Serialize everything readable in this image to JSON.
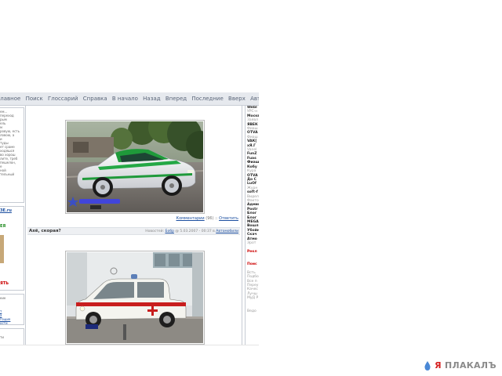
{
  "nav": {
    "items": [
      "Главное",
      "Поиск",
      "Глоссарий",
      "Справка",
      "В начало",
      "Назад",
      "Вперед",
      "Последние",
      "Вверх",
      "Авторское право"
    ]
  },
  "left_sidebar": {
    "box1_lines": [
      "ем...",
      "переход",
      "",
      "рым",
      "ель",
      "м",
      "ровую, есть",
      "ловою, а",
      "",
      "",
      "",
      "",
      "и",
      "туды",
      "",
      "ет сраме",
      "ходяшся",
      "во хорош",
      "лите, треб",
      "пешелон,",
      "е",
      "ной",
      "тельный"
    ],
    "box2_red": "ЗЕ.ru",
    "box2_green": "ЕЯ",
    "box2_red2": "ЯТЬ",
    "box3_lines": [
      "кик",
      "т",
      "а",
      "гощие",
      "ости"
    ],
    "box4_lines": [
      "",
      "ти"
    ]
  },
  "post1": {
    "comments_label": "Комментарии",
    "comments_count": "(96)",
    "reply_label": "Ответить"
  },
  "post2": {
    "title": "Ахё, скорая?",
    "author_label": "Новостей:",
    "author": "Бобр",
    "date": "@ 5.03.2007 - 00:37",
    "category_prefix": "в",
    "category": "Автомобили"
  },
  "right_sidebar": {
    "lines": [
      {
        "t": "Webl",
        "c": "b"
      },
      {
        "t": "УРС-н",
        "c": "g"
      },
      {
        "t": "Москв",
        "c": "b"
      },
      {
        "t": "Заявл",
        "c": "g"
      },
      {
        "t": "ЯВЕК",
        "c": "b"
      },
      {
        "t": "Фиаш",
        "c": "g"
      },
      {
        "t": "OTVA",
        "c": "b"
      },
      {
        "t": "Фиаш",
        "c": "g"
      },
      {
        "t": "VAК[",
        "c": "b"
      },
      {
        "t": "xЯ.Г",
        "c": "b"
      },
      {
        "t": "Vanel",
        "c": "g"
      },
      {
        "t": "FunZ",
        "c": "b"
      },
      {
        "t": "Fuas",
        "c": "b"
      },
      {
        "t": "Фиаш",
        "c": "b"
      },
      {
        "t": "Кобу",
        "c": "b"
      },
      {
        "t": "Кура",
        "c": "g"
      },
      {
        "t": "OTVA",
        "c": "b"
      },
      {
        "t": "До С",
        "c": "b"
      },
      {
        "t": "LuOf",
        "c": "b"
      },
      {
        "t": "Журн",
        "c": "g"
      },
      {
        "t": "soft-f",
        "c": "b"
      },
      {
        "t": "Видел",
        "c": "g"
      },
      {
        "t": "Факто",
        "c": "g"
      },
      {
        "t": "Админ",
        "c": "b"
      },
      {
        "t": "Postr",
        "c": "b"
      },
      {
        "t": "Блог",
        "c": "b"
      },
      {
        "t": "Блог",
        "c": "b"
      },
      {
        "t": "MEGA",
        "c": "b"
      },
      {
        "t": "Вошл",
        "c": "b"
      },
      {
        "t": "Убойн",
        "c": "b"
      },
      {
        "t": "Скач",
        "c": "b"
      },
      {
        "t": "Атмо",
        "c": "b"
      },
      {
        "t": "Эрот",
        "c": "g"
      },
      {
        "t": "",
        "c": "g"
      },
      {
        "t": "Рекл",
        "c": "r"
      },
      {
        "t": "",
        "c": "g"
      },
      {
        "t": "",
        "c": "g"
      },
      {
        "t": "Поис",
        "c": "r"
      },
      {
        "t": "",
        "c": "g"
      },
      {
        "t": "Всть",
        "c": "g"
      },
      {
        "t": "Подбо",
        "c": "g"
      },
      {
        "t": "Все п",
        "c": "g"
      },
      {
        "t": "Переу",
        "c": "g"
      },
      {
        "t": "Качес",
        "c": "g"
      },
      {
        "t": "Лучш",
        "c": "g"
      },
      {
        "t": "МуД Р",
        "c": "g"
      },
      {
        "t": "",
        "c": "g"
      },
      {
        "t": "",
        "c": "g"
      },
      {
        "t": "Ведо",
        "c": "g"
      }
    ]
  },
  "watermark": {
    "prefix": "Я",
    "brand": "ПЛАКАЛЪ",
    "drop_icon": "water-drop-icon"
  },
  "colors": {
    "nav_bg": "#e6e9ee",
    "link": "#1c4fa0",
    "accent_red": "#cc0000",
    "accent_green": "#1e8a1e"
  }
}
